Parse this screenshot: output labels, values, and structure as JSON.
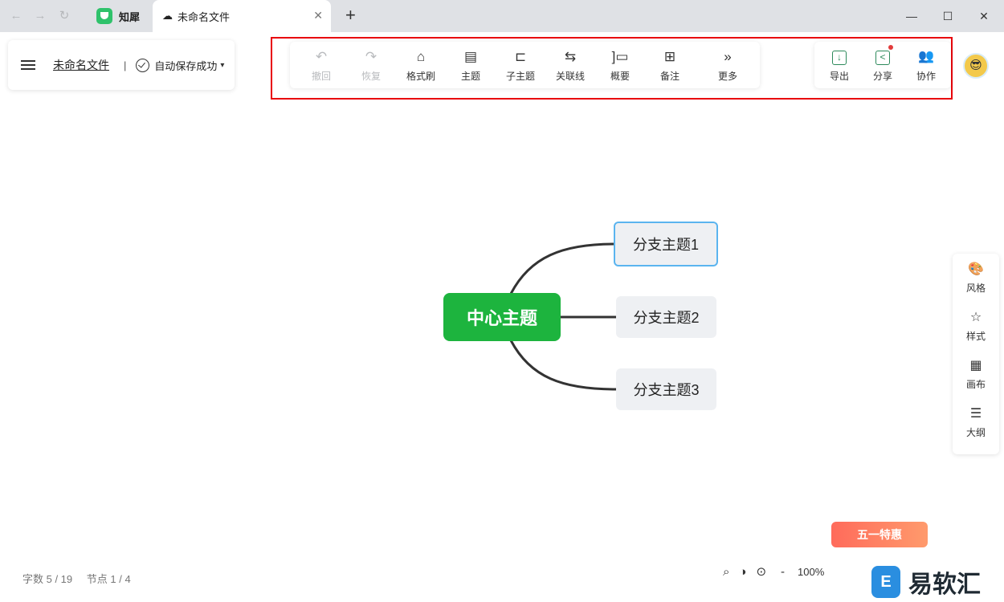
{
  "browser": {
    "nav": {
      "back": "←",
      "forward": "→",
      "reload": "↻"
    },
    "tabs": [
      {
        "label": "知犀",
        "icon": "zhixi-logo-icon"
      },
      {
        "label": "未命名文件",
        "icon": "cloud-icon",
        "close": "✕"
      }
    ],
    "new_tab": "+",
    "window": {
      "minimize": "—",
      "maximize": "☐",
      "close": "✕"
    }
  },
  "file": {
    "name": "未命名文件",
    "separator": "|",
    "save_status": "自动保存成功",
    "caret": "▾"
  },
  "toolbar": {
    "items": [
      {
        "label": "撤回",
        "icon": "undo-icon",
        "glyph": "↶",
        "enabled": false
      },
      {
        "label": "恢复",
        "icon": "redo-icon",
        "glyph": "↷",
        "enabled": false
      },
      {
        "label": "格式刷",
        "icon": "format-brush-icon",
        "glyph": "⌂",
        "enabled": true
      },
      {
        "label": "主题",
        "icon": "topic-icon",
        "glyph": "▤",
        "enabled": true
      },
      {
        "label": "子主题",
        "icon": "subtopic-icon",
        "glyph": "⊏",
        "enabled": true
      },
      {
        "label": "关联线",
        "icon": "relation-line-icon",
        "glyph": "⇆",
        "enabled": true
      },
      {
        "label": "概要",
        "icon": "summary-icon",
        "glyph": "]▭",
        "enabled": true
      },
      {
        "label": "备注",
        "icon": "note-icon",
        "glyph": "⊞",
        "enabled": true
      },
      {
        "label": "更多",
        "icon": "more-icon",
        "glyph": "»",
        "enabled": true
      }
    ]
  },
  "actions": {
    "items": [
      {
        "label": "导出",
        "icon": "export-icon",
        "glyph": "↓"
      },
      {
        "label": "分享",
        "icon": "share-icon",
        "glyph": "<"
      },
      {
        "label": "协作",
        "icon": "collaborate-icon",
        "glyph": "👥"
      }
    ],
    "avatar": "😎"
  },
  "side_panel": {
    "items": [
      {
        "label": "风格",
        "icon": "palette-icon",
        "glyph": "🎨"
      },
      {
        "label": "样式",
        "icon": "style-icon",
        "glyph": "☆"
      },
      {
        "label": "画布",
        "icon": "canvas-icon",
        "glyph": "▦"
      },
      {
        "label": "大纲",
        "icon": "outline-icon",
        "glyph": "☰"
      }
    ]
  },
  "mindmap": {
    "center": "中心主题",
    "branches": [
      "分支主题1",
      "分支主题2",
      "分支主题3"
    ],
    "colors": {
      "center": "#1db43e",
      "branch_bg": "#eef0f3",
      "selected_border": "#5ab4ef",
      "line": "#333333"
    }
  },
  "status": {
    "words": "字数 5 / 19",
    "nodes": "节点 1 / 4"
  },
  "zoom": {
    "search": "⌕",
    "mode": "◑",
    "locate": "⊙",
    "minus": "-",
    "value": "100%"
  },
  "promo": "五一特惠",
  "watermark": {
    "logo": "E",
    "text": "易软汇"
  }
}
